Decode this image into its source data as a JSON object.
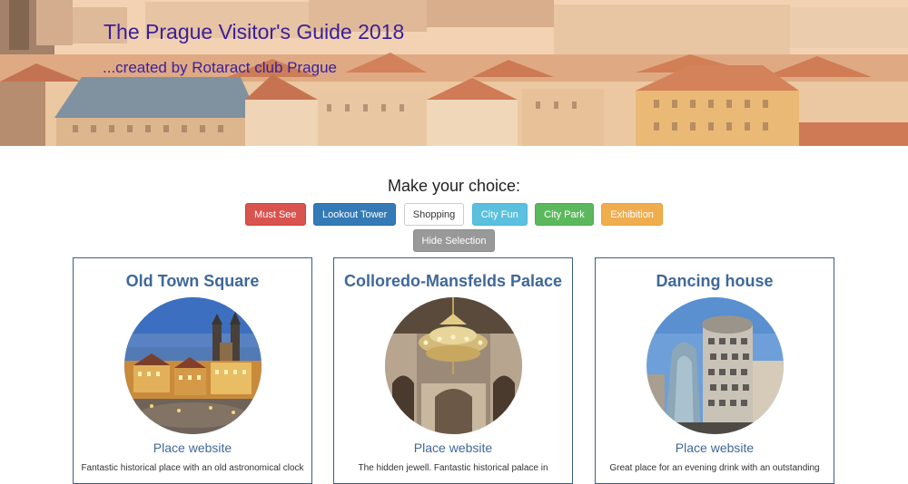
{
  "banner": {
    "title": "The Prague Visitor's Guide 2018",
    "subtitle": "...created by Rotaract club Prague"
  },
  "choice": {
    "heading": "Make your choice:",
    "filters": [
      {
        "label": "Must See",
        "color": "#d9534f"
      },
      {
        "label": "Lookout Tower",
        "color": "#337ab7"
      },
      {
        "label": "Shopping",
        "color": "#ffffff"
      },
      {
        "label": "City Fun",
        "color": "#5bc0de"
      },
      {
        "label": "City Park",
        "color": "#5cb85c"
      },
      {
        "label": "Exhibition",
        "color": "#f0ad4e"
      }
    ],
    "hide_label": "Hide Selection"
  },
  "cards": [
    {
      "title": "Old Town Square",
      "link": "Place website",
      "description": "Fantastic historical place with an old astronomical clock"
    },
    {
      "title": "Colloredo-Mansfelds Palace",
      "link": "Place website",
      "description": "The hidden jewell. Fantastic historical palace in"
    },
    {
      "title": "Dancing house",
      "link": "Place website",
      "description": "Great place for an evening drink with an outstanding"
    }
  ],
  "colors": {
    "title_purple": "#3a1f9a",
    "card_blue": "#3f6899",
    "card_border": "#3b5f8a"
  }
}
